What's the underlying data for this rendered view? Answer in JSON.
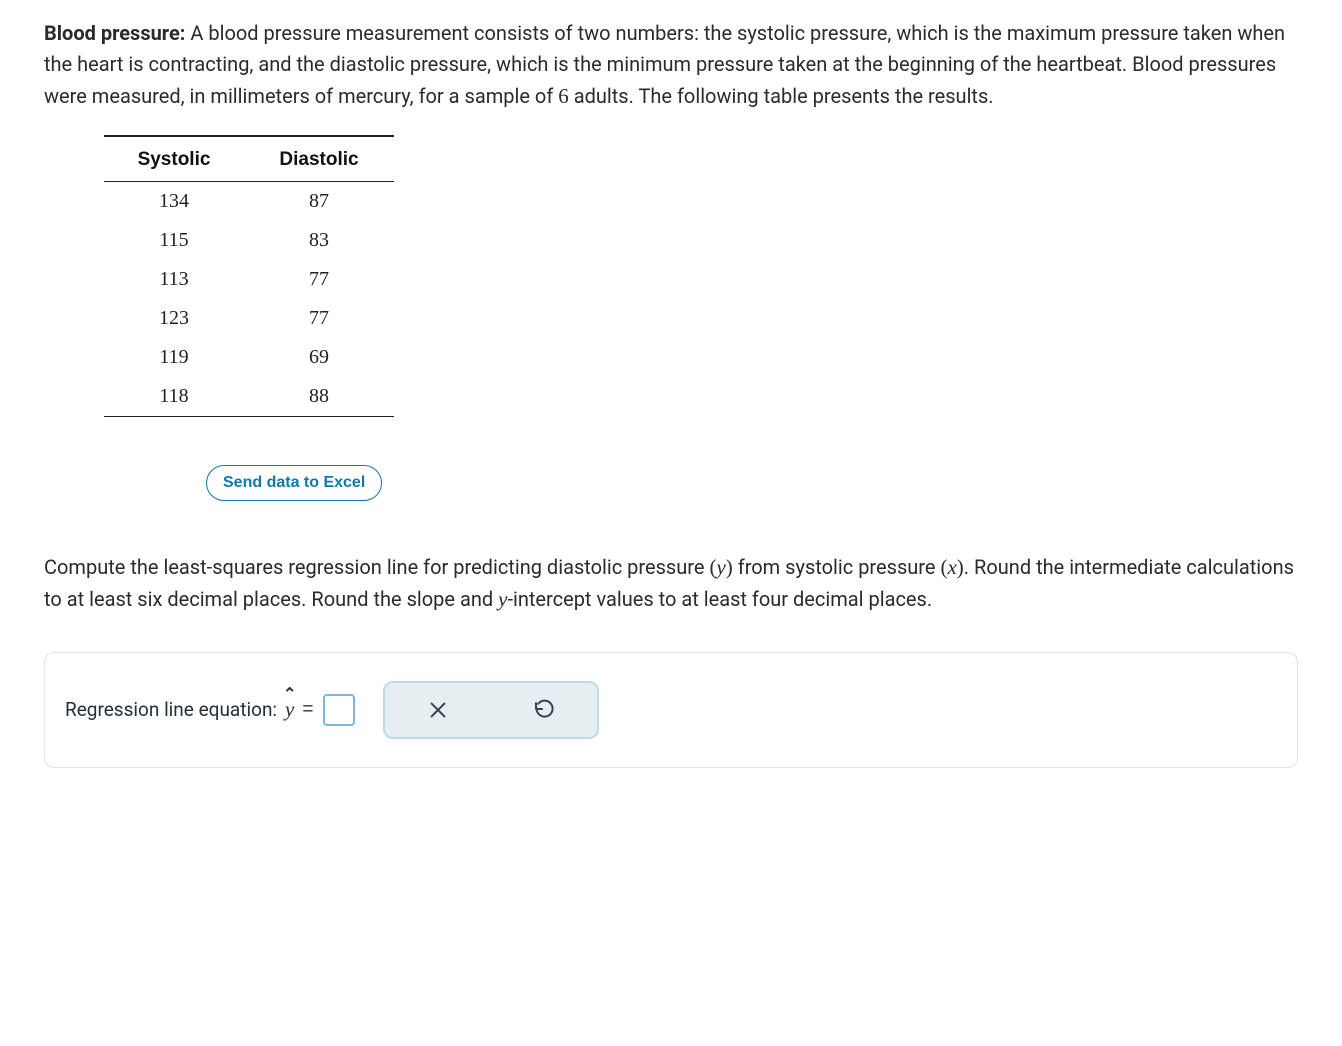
{
  "prompt": {
    "title": "Blood pressure:",
    "body_before_number": " A blood pressure measurement consists of two numbers: the systolic pressure, which is the maximum pressure taken when the heart is contracting, and the diastolic pressure, which is the minimum pressure taken at the beginning of the heartbeat. Blood pressures were measured, in millimeters of mercury, for a sample of ",
    "sample_size": "6",
    "body_after_number": " adults. The following table presents the results."
  },
  "table": {
    "headers": {
      "col1": "Systolic",
      "col2": "Diastolic"
    },
    "rows": [
      {
        "systolic": "134",
        "diastolic": "87"
      },
      {
        "systolic": "115",
        "diastolic": "83"
      },
      {
        "systolic": "113",
        "diastolic": "77"
      },
      {
        "systolic": "123",
        "diastolic": "77"
      },
      {
        "systolic": "119",
        "diastolic": "69"
      },
      {
        "systolic": "118",
        "diastolic": "88"
      }
    ]
  },
  "excel_button": "Send data to Excel",
  "instructions": {
    "part1": "Compute the least-squares regression line for predicting diastolic pressure ",
    "var_y": "y",
    "part2": " from systolic pressure ",
    "var_x": "x",
    "part3": ". Round the intermediate calculations to at least six decimal places. Round the slope and ",
    "yintercept_var": "y",
    "part4": "-intercept values to at least four decimal places."
  },
  "answer": {
    "label": "Regression line equation: ",
    "yhat": "y",
    "hat_symbol": "⌃",
    "equals": "=",
    "input_value": ""
  }
}
